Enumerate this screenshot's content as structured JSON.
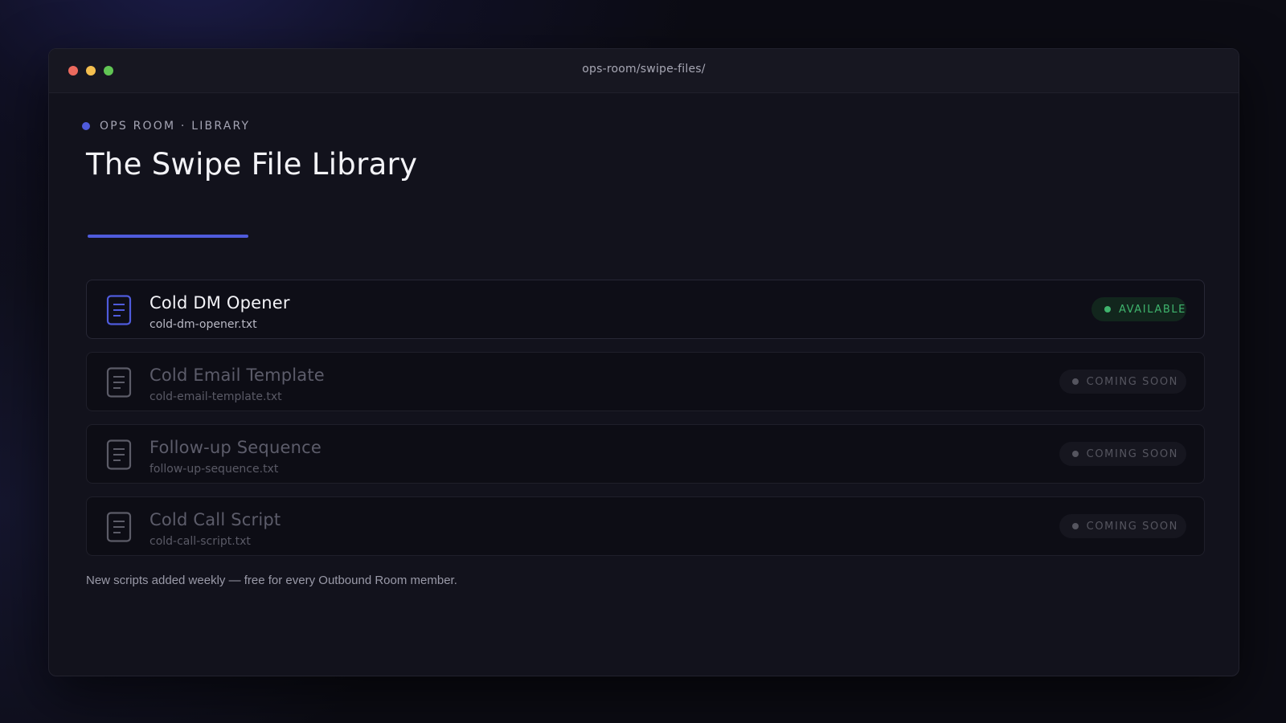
{
  "window": {
    "title": "ops-room/swipe-files/",
    "controls": {
      "close_color": "#ec6a5e",
      "minimize_color": "#f4bf4f",
      "maximize_color": "#61c554"
    }
  },
  "header": {
    "eyebrow": "OPS ROOM · LIBRARY",
    "title": "The Swipe File Library",
    "accent_color": "#4f5bdc"
  },
  "files": [
    {
      "name": "Cold DM Opener",
      "filename": "cold-dm-opener.txt",
      "status": "AVAILABLE",
      "icon": "document-icon",
      "status_color": "#3fb46d",
      "icon_color": "#4f5bdc"
    },
    {
      "name": "Cold Email Template",
      "filename": "cold-email-template.txt",
      "status": "COMING SOON",
      "icon": "document-icon",
      "status_color": "#55555f",
      "icon_color": "#5c5c68"
    },
    {
      "name": "Follow-up Sequence",
      "filename": "follow-up-sequence.txt",
      "status": "COMING SOON",
      "icon": "document-icon",
      "status_color": "#55555f",
      "icon_color": "#5c5c68"
    },
    {
      "name": "Cold Call Script",
      "filename": "cold-call-script.txt",
      "status": "COMING SOON",
      "icon": "document-icon",
      "status_color": "#55555f",
      "icon_color": "#5c5c68"
    }
  ],
  "footer": {
    "note": "New scripts added weekly — free for every Outbound Room member."
  }
}
